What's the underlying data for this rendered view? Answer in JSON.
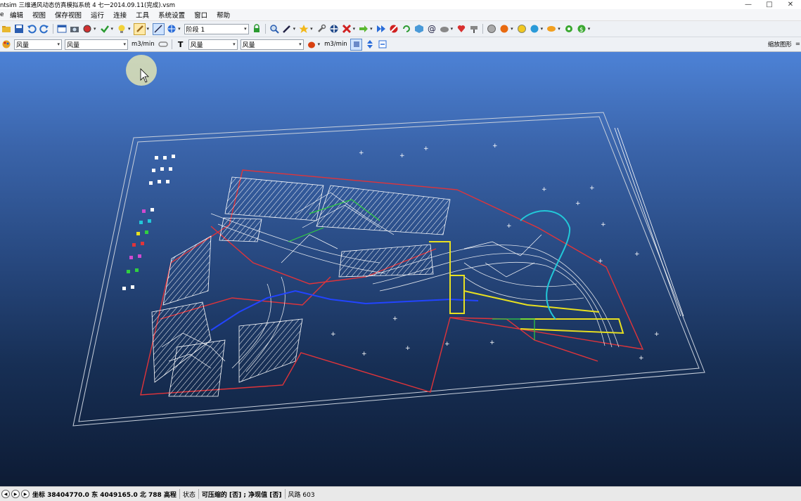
{
  "window": {
    "title": "ntsim 三维通风动态仿真模拟系统 4    七一2014.09.11(完成).vsm",
    "minimize": "—",
    "maximize": "□",
    "close": "✕"
  },
  "menu": {
    "items": [
      {
        "label": "编辑"
      },
      {
        "label": "视图"
      },
      {
        "label": "保存视图"
      },
      {
        "label": "运行"
      },
      {
        "label": "连接"
      },
      {
        "label": "工具"
      },
      {
        "label": "系统设置"
      },
      {
        "label": "窗口"
      },
      {
        "label": "帮助"
      }
    ]
  },
  "toolbar1": {
    "stage_select": "阶段 1",
    "icons": [
      "open-icon",
      "save-icon",
      "undo-icon",
      "redo-icon",
      "window-icon",
      "camera-icon",
      "record-icon",
      "check-icon",
      "bulb-icon",
      "brush-icon",
      "pointer-icon",
      "zoom-icon",
      "pen-icon",
      "star-icon",
      "wrench-icon",
      "fan-icon",
      "delete-icon",
      "arrow-icon",
      "fastforward-icon",
      "stop-icon",
      "refresh-icon",
      "cube-icon",
      "at-icon",
      "cloud-icon",
      "heart-icon",
      "brush2-icon",
      "globe-icon",
      "fire-icon",
      "gauge-icon",
      "bird-icon",
      "leaf-icon",
      "gear-icon",
      "dollar-icon"
    ]
  },
  "toolbar2": {
    "select1": "风量",
    "select2": "风量",
    "unit1": "m3/min",
    "text_label": "T",
    "select3": "风量",
    "select4": "风量",
    "unit2": "m3/min",
    "right_label": "缩放图形"
  },
  "status": {
    "coords_prefix": "坐标",
    "coords": "38404770.0 东   4049165.0 北  788 高程",
    "state": "状态",
    "compress": "可压缩的 [否] ; 净现值 [否]",
    "airway": "风路 603"
  },
  "colors": {
    "red": "#e0343a",
    "white": "#ffffff",
    "blue": "#2244ff",
    "yellow": "#e8e020",
    "cyan": "#22c8d8"
  }
}
